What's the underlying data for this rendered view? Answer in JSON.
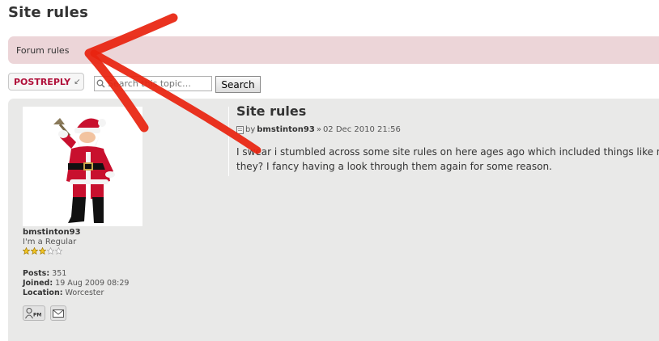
{
  "page": {
    "title": "Site rules"
  },
  "rules_bar": {
    "label": "Forum rules"
  },
  "toolbar": {
    "post_reply_label": "POSTREPLY",
    "search_placeholder": "Search this topic…",
    "search_button_label": "Search"
  },
  "post": {
    "title": "Site rules",
    "author": "bmstinton93",
    "date": "02 Dec 2010 21:56",
    "body_lines": [
      "I swear i stumbled across some site rules on here ages ago which included things like not",
      "they? I fancy having a look through them again for some reason."
    ]
  },
  "profile": {
    "username": "bmstinton93",
    "rank": "I'm a Regular",
    "stars_filled": 3,
    "stars_total": 5,
    "posts_label": "Posts:",
    "posts": "351",
    "joined_label": "Joined:",
    "joined": "19 Aug 2009 08:29",
    "location_label": "Location:",
    "location": "Worcester",
    "pm_label": "PM"
  },
  "colors": {
    "rules_bg": "#ecd5d8",
    "accent": "#b0103a",
    "arrow": "#e8230f",
    "panel_bg": "#e9e9e8"
  }
}
